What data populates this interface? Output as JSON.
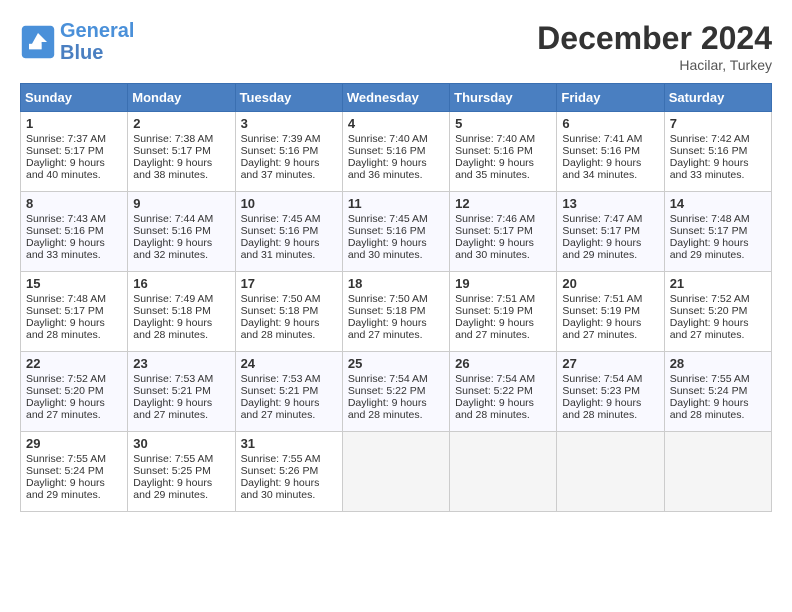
{
  "header": {
    "logo_line1": "General",
    "logo_line2": "Blue",
    "month_title": "December 2024",
    "location": "Hacilar, Turkey"
  },
  "weekdays": [
    "Sunday",
    "Monday",
    "Tuesday",
    "Wednesday",
    "Thursday",
    "Friday",
    "Saturday"
  ],
  "weeks": [
    [
      {
        "day": "1",
        "sunrise": "Sunrise: 7:37 AM",
        "sunset": "Sunset: 5:17 PM",
        "daylight": "Daylight: 9 hours and 40 minutes."
      },
      {
        "day": "2",
        "sunrise": "Sunrise: 7:38 AM",
        "sunset": "Sunset: 5:17 PM",
        "daylight": "Daylight: 9 hours and 38 minutes."
      },
      {
        "day": "3",
        "sunrise": "Sunrise: 7:39 AM",
        "sunset": "Sunset: 5:16 PM",
        "daylight": "Daylight: 9 hours and 37 minutes."
      },
      {
        "day": "4",
        "sunrise": "Sunrise: 7:40 AM",
        "sunset": "Sunset: 5:16 PM",
        "daylight": "Daylight: 9 hours and 36 minutes."
      },
      {
        "day": "5",
        "sunrise": "Sunrise: 7:40 AM",
        "sunset": "Sunset: 5:16 PM",
        "daylight": "Daylight: 9 hours and 35 minutes."
      },
      {
        "day": "6",
        "sunrise": "Sunrise: 7:41 AM",
        "sunset": "Sunset: 5:16 PM",
        "daylight": "Daylight: 9 hours and 34 minutes."
      },
      {
        "day": "7",
        "sunrise": "Sunrise: 7:42 AM",
        "sunset": "Sunset: 5:16 PM",
        "daylight": "Daylight: 9 hours and 33 minutes."
      }
    ],
    [
      {
        "day": "8",
        "sunrise": "Sunrise: 7:43 AM",
        "sunset": "Sunset: 5:16 PM",
        "daylight": "Daylight: 9 hours and 33 minutes."
      },
      {
        "day": "9",
        "sunrise": "Sunrise: 7:44 AM",
        "sunset": "Sunset: 5:16 PM",
        "daylight": "Daylight: 9 hours and 32 minutes."
      },
      {
        "day": "10",
        "sunrise": "Sunrise: 7:45 AM",
        "sunset": "Sunset: 5:16 PM",
        "daylight": "Daylight: 9 hours and 31 minutes."
      },
      {
        "day": "11",
        "sunrise": "Sunrise: 7:45 AM",
        "sunset": "Sunset: 5:16 PM",
        "daylight": "Daylight: 9 hours and 30 minutes."
      },
      {
        "day": "12",
        "sunrise": "Sunrise: 7:46 AM",
        "sunset": "Sunset: 5:17 PM",
        "daylight": "Daylight: 9 hours and 30 minutes."
      },
      {
        "day": "13",
        "sunrise": "Sunrise: 7:47 AM",
        "sunset": "Sunset: 5:17 PM",
        "daylight": "Daylight: 9 hours and 29 minutes."
      },
      {
        "day": "14",
        "sunrise": "Sunrise: 7:48 AM",
        "sunset": "Sunset: 5:17 PM",
        "daylight": "Daylight: 9 hours and 29 minutes."
      }
    ],
    [
      {
        "day": "15",
        "sunrise": "Sunrise: 7:48 AM",
        "sunset": "Sunset: 5:17 PM",
        "daylight": "Daylight: 9 hours and 28 minutes."
      },
      {
        "day": "16",
        "sunrise": "Sunrise: 7:49 AM",
        "sunset": "Sunset: 5:18 PM",
        "daylight": "Daylight: 9 hours and 28 minutes."
      },
      {
        "day": "17",
        "sunrise": "Sunrise: 7:50 AM",
        "sunset": "Sunset: 5:18 PM",
        "daylight": "Daylight: 9 hours and 28 minutes."
      },
      {
        "day": "18",
        "sunrise": "Sunrise: 7:50 AM",
        "sunset": "Sunset: 5:18 PM",
        "daylight": "Daylight: 9 hours and 27 minutes."
      },
      {
        "day": "19",
        "sunrise": "Sunrise: 7:51 AM",
        "sunset": "Sunset: 5:19 PM",
        "daylight": "Daylight: 9 hours and 27 minutes."
      },
      {
        "day": "20",
        "sunrise": "Sunrise: 7:51 AM",
        "sunset": "Sunset: 5:19 PM",
        "daylight": "Daylight: 9 hours and 27 minutes."
      },
      {
        "day": "21",
        "sunrise": "Sunrise: 7:52 AM",
        "sunset": "Sunset: 5:20 PM",
        "daylight": "Daylight: 9 hours and 27 minutes."
      }
    ],
    [
      {
        "day": "22",
        "sunrise": "Sunrise: 7:52 AM",
        "sunset": "Sunset: 5:20 PM",
        "daylight": "Daylight: 9 hours and 27 minutes."
      },
      {
        "day": "23",
        "sunrise": "Sunrise: 7:53 AM",
        "sunset": "Sunset: 5:21 PM",
        "daylight": "Daylight: 9 hours and 27 minutes."
      },
      {
        "day": "24",
        "sunrise": "Sunrise: 7:53 AM",
        "sunset": "Sunset: 5:21 PM",
        "daylight": "Daylight: 9 hours and 27 minutes."
      },
      {
        "day": "25",
        "sunrise": "Sunrise: 7:54 AM",
        "sunset": "Sunset: 5:22 PM",
        "daylight": "Daylight: 9 hours and 28 minutes."
      },
      {
        "day": "26",
        "sunrise": "Sunrise: 7:54 AM",
        "sunset": "Sunset: 5:22 PM",
        "daylight": "Daylight: 9 hours and 28 minutes."
      },
      {
        "day": "27",
        "sunrise": "Sunrise: 7:54 AM",
        "sunset": "Sunset: 5:23 PM",
        "daylight": "Daylight: 9 hours and 28 minutes."
      },
      {
        "day": "28",
        "sunrise": "Sunrise: 7:55 AM",
        "sunset": "Sunset: 5:24 PM",
        "daylight": "Daylight: 9 hours and 28 minutes."
      }
    ],
    [
      {
        "day": "29",
        "sunrise": "Sunrise: 7:55 AM",
        "sunset": "Sunset: 5:24 PM",
        "daylight": "Daylight: 9 hours and 29 minutes."
      },
      {
        "day": "30",
        "sunrise": "Sunrise: 7:55 AM",
        "sunset": "Sunset: 5:25 PM",
        "daylight": "Daylight: 9 hours and 29 minutes."
      },
      {
        "day": "31",
        "sunrise": "Sunrise: 7:55 AM",
        "sunset": "Sunset: 5:26 PM",
        "daylight": "Daylight: 9 hours and 30 minutes."
      },
      null,
      null,
      null,
      null
    ]
  ]
}
